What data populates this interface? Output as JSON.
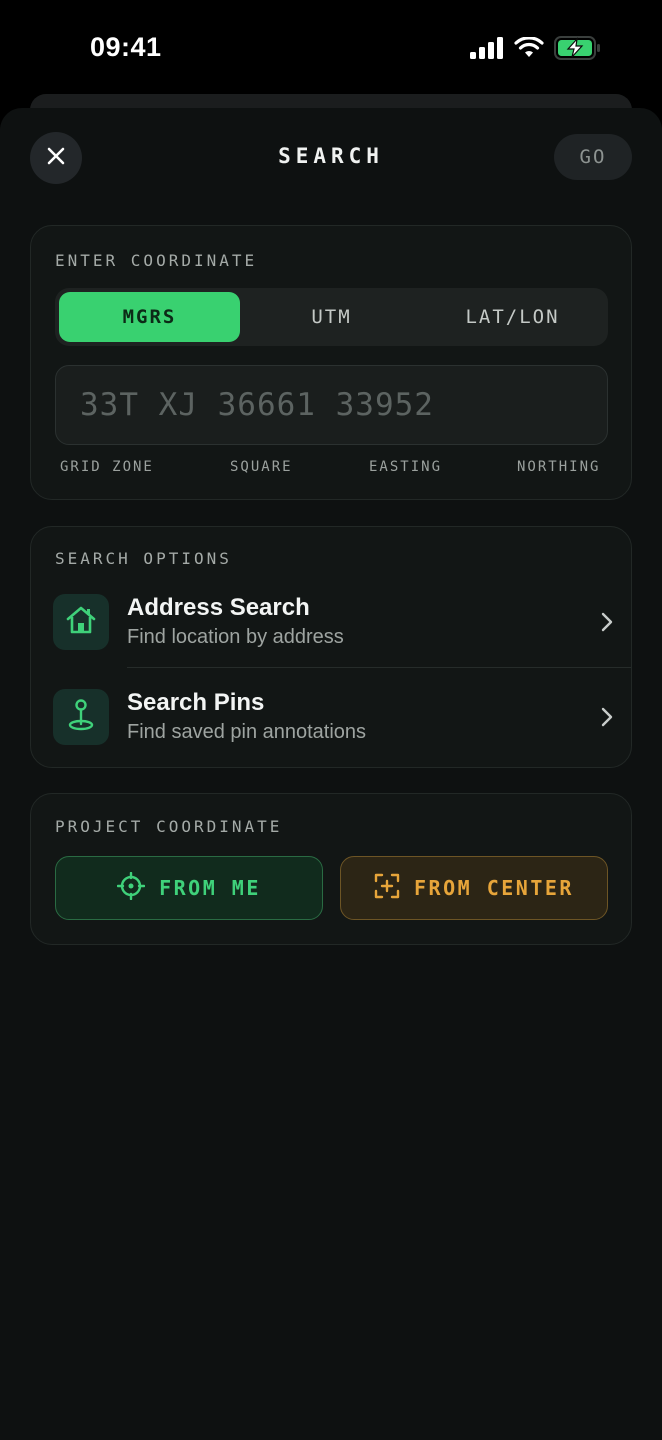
{
  "status_bar": {
    "time": "09:41",
    "icons": [
      "cellular-signal-icon",
      "wifi-icon",
      "battery-charging-icon"
    ]
  },
  "header": {
    "close_icon": "close-icon",
    "title": "SEARCH",
    "go_label": "GO"
  },
  "coordinate": {
    "section_label": "ENTER COORDINATE",
    "tabs": [
      {
        "label": "MGRS",
        "active": true
      },
      {
        "label": "UTM",
        "active": false
      },
      {
        "label": "LAT/LON",
        "active": false
      }
    ],
    "input_value": "",
    "input_placeholder": "33T XJ 36661 33952",
    "hints": [
      "GRID ZONE",
      "SQUARE",
      "EASTING",
      "NORTHING"
    ]
  },
  "search_options": {
    "section_label": "SEARCH OPTIONS",
    "items": [
      {
        "icon": "house-icon",
        "title": "Address Search",
        "subtitle": "Find location by address"
      },
      {
        "icon": "pin-icon",
        "title": "Search Pins",
        "subtitle": "Find saved pin annotations"
      }
    ]
  },
  "project": {
    "section_label": "PROJECT COORDINATE",
    "from_me_label": "FROM ME",
    "from_center_label": "FROM CENTER"
  },
  "colors": {
    "accent_green": "#39d170",
    "accent_amber": "#e7a53a",
    "background": "#0e1111"
  }
}
